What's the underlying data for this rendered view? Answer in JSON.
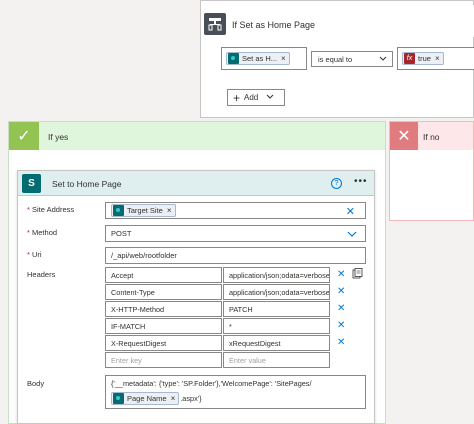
{
  "condition": {
    "title": "If Set as Home Page",
    "left_token": "Set as H...",
    "operator": "is equal to",
    "right_token": "true",
    "add_label": "Add"
  },
  "branches": {
    "yes_label": "If yes",
    "no_label": "If no"
  },
  "action": {
    "title": "Set to Home Page",
    "site_address_label": "Site Address",
    "site_address_token": "Target Site",
    "method_label": "Method",
    "method_value": "POST",
    "uri_label": "Uri",
    "uri_value": "/_api/web/rootfolder",
    "headers_label": "Headers",
    "headers": [
      {
        "key": "Accept",
        "value": "application/json;odata=verbose"
      },
      {
        "key": "Content-Type",
        "value": "application/json;odata=verbose"
      },
      {
        "key": "X-HTTP-Method",
        "value": "PATCH"
      },
      {
        "key": "IF-MATCH",
        "value": "*"
      },
      {
        "key": "X-RequestDigest",
        "value": "xRequestDigest"
      }
    ],
    "key_placeholder": "Enter key",
    "value_placeholder": "Enter value",
    "body_label": "Body",
    "body_line1": "{'__metadata': {'type': 'SP.Folder'},'WelcomePage': 'SitePages/",
    "body_token": "Page Name",
    "body_line2_suffix": ".aspx'}"
  },
  "colors": {
    "accent": "#0078d4",
    "sharepoint": "#036c70",
    "yes_green": "#92c353",
    "no_red": "#e07b7f",
    "required": "#a4262c"
  }
}
